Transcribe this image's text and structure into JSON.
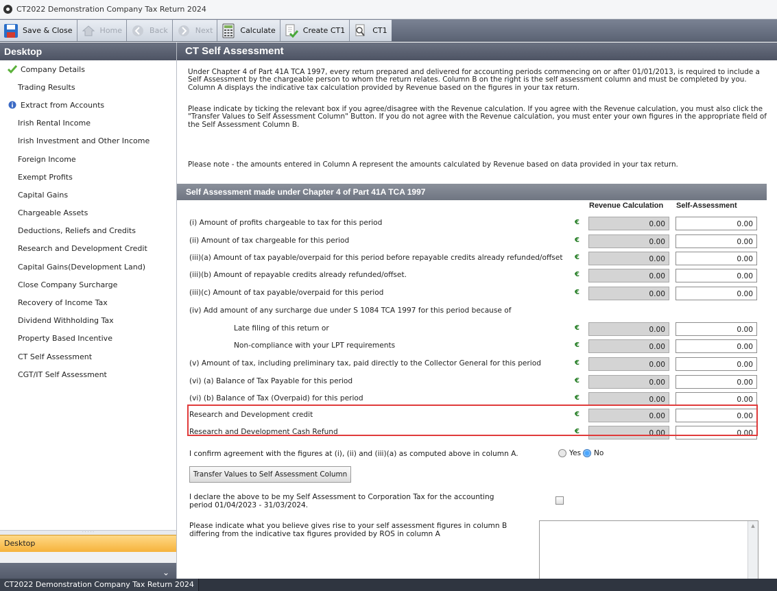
{
  "window": {
    "title": "CT2022 Demonstration Company Tax Return 2024"
  },
  "toolbar": {
    "save_close": "Save & Close",
    "home": "Home",
    "back": "Back",
    "next": "Next",
    "calculate": "Calculate",
    "create_ct1": "Create CT1",
    "ct1": "CT1"
  },
  "sidebar": {
    "header": "Desktop",
    "items": [
      {
        "label": "Company Details",
        "status": "check"
      },
      {
        "label": "Trading Results",
        "status": ""
      },
      {
        "label": "Extract from Accounts",
        "status": "info"
      },
      {
        "label": "Irish Rental Income",
        "status": ""
      },
      {
        "label": "Irish Investment and Other Income",
        "status": ""
      },
      {
        "label": "Foreign Income",
        "status": ""
      },
      {
        "label": "Exempt Profits",
        "status": ""
      },
      {
        "label": "Capital Gains",
        "status": ""
      },
      {
        "label": "Chargeable Assets",
        "status": ""
      },
      {
        "label": "Deductions, Reliefs and Credits",
        "status": ""
      },
      {
        "label": "Research and Development Credit",
        "status": ""
      },
      {
        "label": "Capital Gains(Development Land)",
        "status": ""
      },
      {
        "label": "Close Company Surcharge",
        "status": ""
      },
      {
        "label": "Recovery of Income Tax",
        "status": ""
      },
      {
        "label": "Dividend Withholding Tax",
        "status": ""
      },
      {
        "label": "Property Based Incentive",
        "status": ""
      },
      {
        "label": "CT Self Assessment",
        "status": ""
      },
      {
        "label": "CGT/IT Self Assessment",
        "status": ""
      }
    ],
    "footer_label": "Desktop"
  },
  "main": {
    "title": "CT Self Assessment",
    "intro_p1": "Under Chapter 4 of Part 41A TCA 1997, every return prepared and delivered for accounting periods commencing on or after 01/01/2013, is required to include a Self Assessment by the chargeable person to whom the return relates. Column B on the right is the self assessment column and must be completed by you. Column A displays the indicative tax calculation provided by Revenue based on the figures in your tax return.",
    "intro_p2": "Please indicate by ticking the relevant box if you agree/disagree with the Revenue calculation. If you agree with the Revenue calculation, you must also click the \"Transfer Values to Self Assessment Column\" Button. If you do not agree with the Revenue calculation, you must enter your own figures in the appropriate field of the Self Assessment Column B.",
    "intro_p3": "Please note - the amounts entered in Column A represent the amounts calculated by Revenue based on data provided in your tax return.",
    "section_title": "Self Assessment made under Chapter 4 of Part 41A TCA 1997",
    "col_revenue": "Revenue Calculation",
    "col_self": "Self-Assessment",
    "currency": "€",
    "rows": [
      {
        "label": "(i) Amount of profits chargeable to tax for this period",
        "revenue": "0.00",
        "self": "0.00"
      },
      {
        "label": "(ii) Amount of tax chargeable for this period",
        "revenue": "0.00",
        "self": "0.00"
      },
      {
        "label": "(iii)(a) Amount of tax payable/overpaid for this period before repayable credits already refunded/offset",
        "revenue": "0.00",
        "self": "0.00"
      },
      {
        "label": "(iii)(b) Amount of repayable credits already refunded/offset.",
        "revenue": "0.00",
        "self": "0.00"
      },
      {
        "label": "(iii)(c) Amount of tax payable/overpaid for this period",
        "revenue": "0.00",
        "self": "0.00"
      },
      {
        "label": "Late filing of this return or",
        "revenue": "0.00",
        "self": "0.00"
      },
      {
        "label": "Non-compliance with your LPT requirements",
        "revenue": "0.00",
        "self": "0.00"
      },
      {
        "label": "(v) Amount of tax, including preliminary tax, paid directly to the Collector General for this period",
        "revenue": "0.00",
        "self": "0.00"
      },
      {
        "label": "(vi) (a) Balance of Tax Payable for this period",
        "revenue": "0.00",
        "self": "0.00"
      },
      {
        "label": "(vi) (b) Balance of Tax (Overpaid) for this period",
        "revenue": "0.00",
        "self": "0.00"
      },
      {
        "label": "Research and Development credit",
        "revenue": "0.00",
        "self": "0.00"
      },
      {
        "label": "Research and Development Cash Refund",
        "revenue": "0.00",
        "self": "0.00"
      }
    ],
    "surcharge_heading": "(iv) Add amount of any surcharge due under S 1084 TCA 1997 for this period because of",
    "confirm_text": "I confirm agreement with the figures at (i), (ii) and (iii)(a) as computed above in column A.",
    "yes_label": "Yes",
    "no_label": "No",
    "selected_option": "No",
    "transfer_button": "Transfer Values to Self Assessment Column",
    "declare_text": "I declare the above to be my Self Assessment to Corporation Tax for the accounting period 01/04/2023 - 31/03/2024.",
    "indicate_text": "Please indicate what you believe gives rise to your self assessment figures in column B differing from the indicative tax figures provided by ROS in column A"
  },
  "statusbar": {
    "text": "CT2022 Demonstration Company Tax Return 2024"
  }
}
